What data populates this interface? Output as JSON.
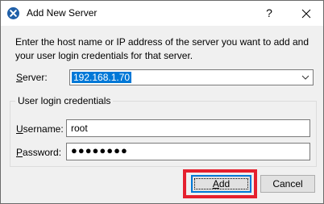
{
  "window": {
    "title": "Add New Server",
    "help_glyph": "?",
    "icons": {
      "app": "app-logo-icon",
      "close": "close-icon"
    }
  },
  "dialog": {
    "instruction": "Enter the host name or IP address of the server you want to add and your user login credentials for that server.",
    "server": {
      "label_accel": "S",
      "label_rest": "erver:",
      "value": "192.168.1.70"
    },
    "credentials": {
      "group_title": "User login credentials",
      "username_label_accel": "U",
      "username_label_rest": "sername:",
      "username_value": "root",
      "password_label_accel": "P",
      "password_label_rest": "assword:",
      "password_masked": "●●●●●●●●"
    },
    "buttons": {
      "add_accel": "A",
      "add_rest": "dd",
      "cancel": "Cancel"
    }
  },
  "colors": {
    "accent": "#0078d7",
    "highlight": "#e5202e"
  }
}
